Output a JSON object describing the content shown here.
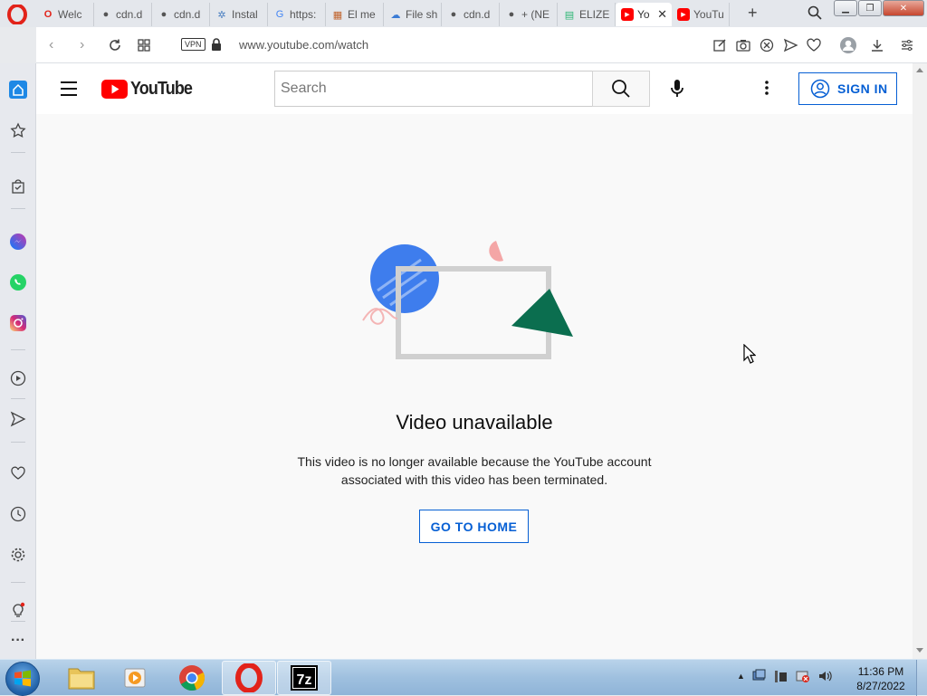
{
  "browser": {
    "tabs": [
      {
        "label": "Welc",
        "icon": "opera-icon",
        "color": "#e2231a"
      },
      {
        "label": "cdn.d",
        "icon": "globe-icon",
        "color": "#555555"
      },
      {
        "label": "cdn.d",
        "icon": "globe-icon",
        "color": "#555555"
      },
      {
        "label": "Instal",
        "icon": "sparkle-icon",
        "color": "#4a7fc1"
      },
      {
        "label": "https:",
        "icon": "google-icon",
        "color": "#4285f4"
      },
      {
        "label": "El me",
        "icon": "page-icon",
        "color": "#c0622b"
      },
      {
        "label": "File sh",
        "icon": "cloud-icon",
        "color": "#3a7bd5"
      },
      {
        "label": "cdn.d",
        "icon": "globe-icon",
        "color": "#555555"
      },
      {
        "label": "+ (NE",
        "icon": "globe-icon",
        "color": "#555555"
      },
      {
        "label": "ELIZE",
        "icon": "chart-icon",
        "color": "#2bb673"
      },
      {
        "label": "Yo",
        "icon": "youtube-icon",
        "color": "#ff0000",
        "active": true
      },
      {
        "label": "YouTu",
        "icon": "youtube-icon",
        "color": "#ff0000"
      }
    ],
    "address": {
      "vpn": "VPN",
      "url": "www.youtube.com/watch"
    }
  },
  "youtube": {
    "logo_text": "YouTube",
    "search_placeholder": "Search",
    "sign_in": "SIGN IN"
  },
  "error": {
    "title": "Video unavailable",
    "message": "This video is no longer available because the YouTube account associated with this video has been terminated.",
    "button": "GO TO HOME"
  },
  "taskbar": {
    "time": "11:36 PM",
    "date": "8/27/2022"
  },
  "colors": {
    "youtube_red": "#ff0000",
    "link_blue": "#065fd4",
    "opera_red": "#e2231a"
  }
}
